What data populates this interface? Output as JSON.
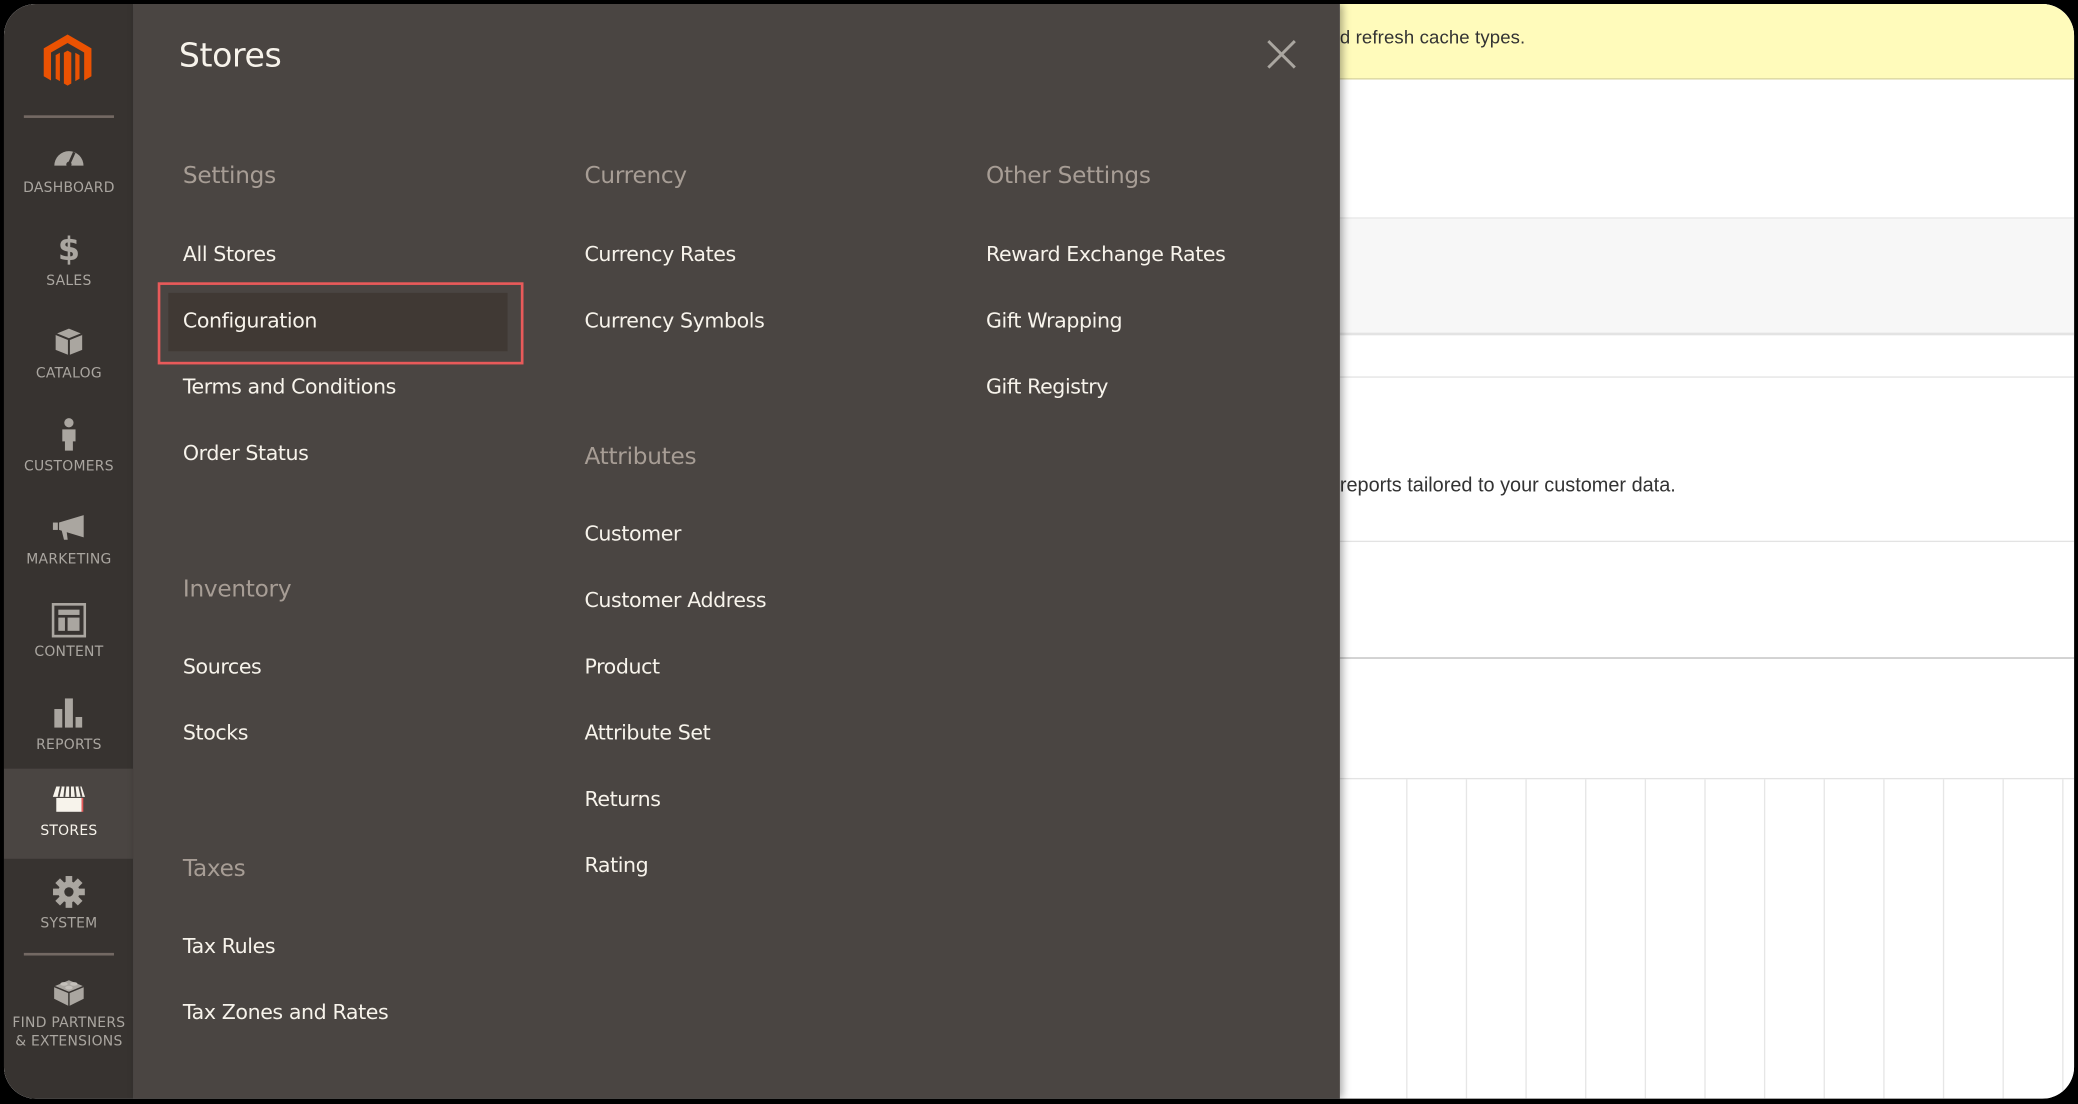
{
  "background": {
    "notice_text": "d refresh cache types.",
    "reports_text": "reports tailored to your customer data."
  },
  "sidebar": {
    "logo": "magento-logo",
    "items": [
      {
        "label": "DASHBOARD",
        "icon": "dashboard-gauge-icon"
      },
      {
        "label": "SALES",
        "icon": "dollar-icon"
      },
      {
        "label": "CATALOG",
        "icon": "box-icon"
      },
      {
        "label": "CUSTOMERS",
        "icon": "person-icon"
      },
      {
        "label": "MARKETING",
        "icon": "megaphone-icon"
      },
      {
        "label": "CONTENT",
        "icon": "layout-icon"
      },
      {
        "label": "REPORTS",
        "icon": "bar-chart-icon"
      },
      {
        "label": "STORES",
        "icon": "storefront-icon",
        "active": true
      },
      {
        "label": "SYSTEM",
        "icon": "gear-icon"
      },
      {
        "label_line1": "FIND PARTNERS",
        "label_line2": "& EXTENSIONS",
        "icon": "lego-brick-icon"
      }
    ]
  },
  "flyout": {
    "title": "Stores",
    "close_icon": "close-icon",
    "columns": [
      {
        "groups": [
          {
            "title": "Settings",
            "links": [
              "All Stores",
              "Configuration",
              "Terms and Conditions",
              "Order Status"
            ]
          },
          {
            "title": "Inventory",
            "links": [
              "Sources",
              "Stocks"
            ]
          },
          {
            "title": "Taxes",
            "links": [
              "Tax Rules",
              "Tax Zones and Rates"
            ]
          }
        ]
      },
      {
        "groups": [
          {
            "title": "Currency",
            "links": [
              "Currency Rates",
              "Currency Symbols"
            ]
          },
          {
            "title": "Attributes",
            "links": [
              "Customer",
              "Customer Address",
              "Product",
              "Attribute Set",
              "Returns",
              "Rating"
            ]
          }
        ]
      },
      {
        "groups": [
          {
            "title": "Other Settings",
            "links": [
              "Reward Exchange Rates",
              "Gift Wrapping",
              "Gift Registry"
            ]
          }
        ]
      }
    ],
    "highlighted_link": "Configuration"
  },
  "colors": {
    "sidebar_bg": "#373330",
    "flyout_bg": "#4a4542",
    "accent_orange": "#eb5202",
    "highlight_border": "#e85a5a",
    "notice_bg": "#fffbbb"
  }
}
